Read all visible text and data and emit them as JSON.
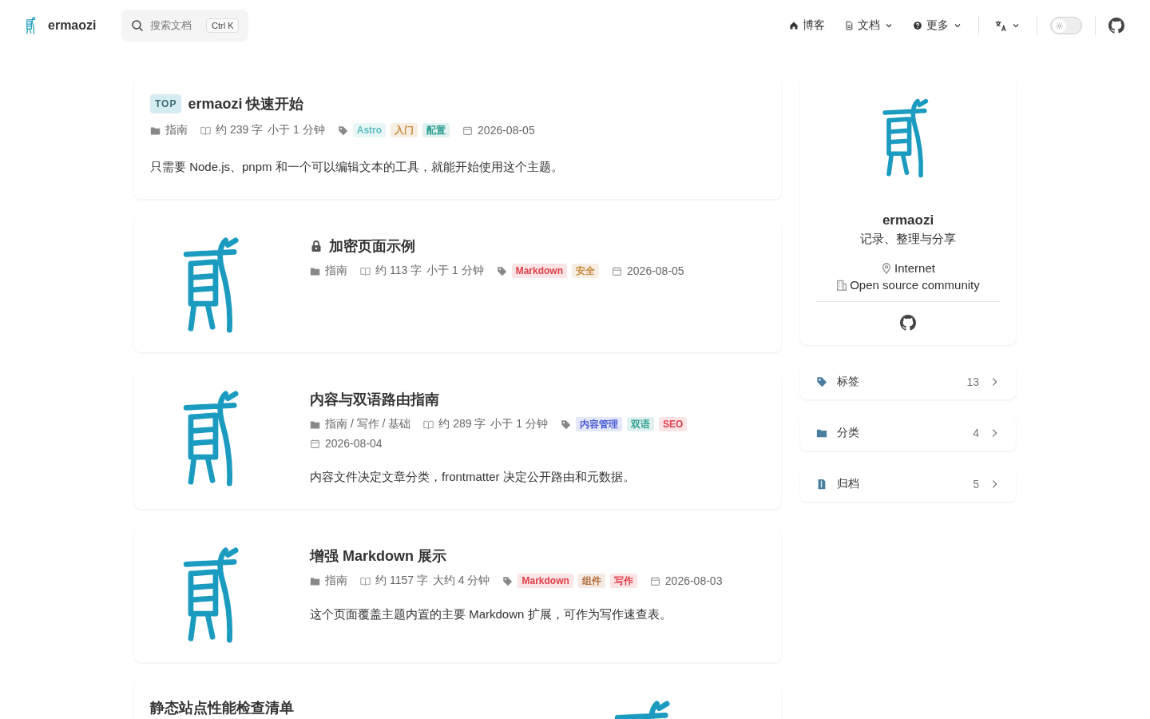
{
  "header": {
    "site_name": "ermaozi",
    "search": {
      "placeholder": "搜索文档",
      "shortcut": "Ctrl K"
    },
    "nav": [
      {
        "label": "博客",
        "kind": "home",
        "dropdown": false
      },
      {
        "label": "文档",
        "kind": "docs",
        "dropdown": true
      },
      {
        "label": "更多",
        "kind": "more",
        "dropdown": true
      }
    ],
    "dark_mode": false
  },
  "posts": [
    {
      "title": "ermaozi 快速开始",
      "badge": "TOP",
      "locked": false,
      "kind": "plain",
      "category": "指南",
      "words": "约 239 字",
      "reading_time": "小于 1 分钟",
      "tags": [
        {
          "label": "Astro",
          "color": "#5bbfc0"
        },
        {
          "label": "入门",
          "color": "#c98a3a"
        },
        {
          "label": "配置",
          "color": "#2a9d8f"
        }
      ],
      "date": "2026-08-05",
      "excerpt": "只需要 Node.js、pnpm 和一个可以编辑文本的工具，就能开始使用这个主题。"
    },
    {
      "title": "加密页面示例",
      "locked": true,
      "kind": "cover_left",
      "category": "指南",
      "words": "约 113 字",
      "reading_time": "小于 1 分钟",
      "tags": [
        {
          "label": "Markdown",
          "color": "#e0404a"
        },
        {
          "label": "安全",
          "color": "#c48a3a"
        }
      ],
      "date": "2026-08-05"
    },
    {
      "title": "内容与双语路由指南",
      "locked": false,
      "kind": "cover_left",
      "category": "指南 / 写作 / 基础",
      "words": "约 289 字",
      "reading_time": "小于 1 分钟",
      "tags": [
        {
          "label": "内容管理",
          "color": "#4a5bd4"
        },
        {
          "label": "双语",
          "color": "#2a9d8f"
        },
        {
          "label": "SEO",
          "color": "#e0404a"
        }
      ],
      "date": "2026-08-04",
      "excerpt": "内容文件决定文章分类，frontmatter 决定公开路由和元数据。"
    },
    {
      "title": "增强 Markdown 展示",
      "locked": false,
      "kind": "cover_left",
      "category": "指南",
      "words": "约 1157 字",
      "reading_time": "大约 4 分钟",
      "tags": [
        {
          "label": "Markdown",
          "color": "#e0404a"
        },
        {
          "label": "组件",
          "color": "#b06a3a"
        },
        {
          "label": "写作",
          "color": "#e0404a"
        }
      ],
      "date": "2026-08-03",
      "excerpt": "这个页面覆盖主题内置的主要 Markdown 扩展，可作为写作速查表。"
    },
    {
      "title": "静态站点性能检查清单",
      "locked": false,
      "kind": "cover_right"
    }
  ],
  "profile": {
    "name": "ermaozi",
    "bio": "记录、整理与分享",
    "location": "Internet",
    "organization": "Open source community"
  },
  "stats": [
    {
      "label": "标签",
      "count": "13"
    },
    {
      "label": "分类",
      "count": "4"
    },
    {
      "label": "归档",
      "count": "5"
    }
  ]
}
